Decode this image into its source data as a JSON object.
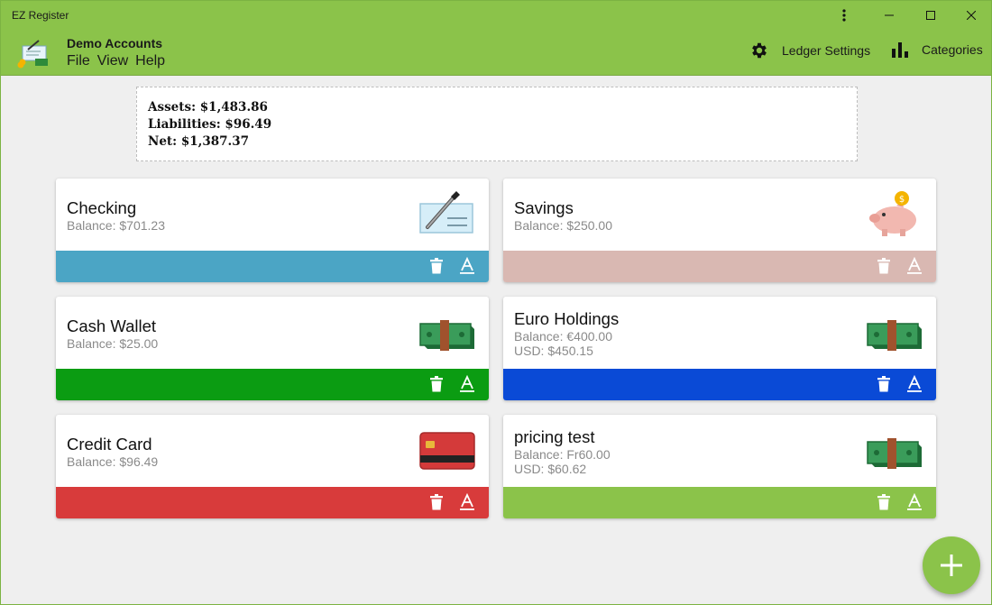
{
  "window": {
    "title": "EZ Register"
  },
  "header": {
    "ledger_name": "Demo Accounts",
    "menu": [
      "File",
      "View",
      "Help"
    ],
    "ledger_settings_label": "Ledger Settings",
    "categories_label": "Categories"
  },
  "summary": {
    "assets": "Assets: $1,483.86",
    "liabilities": "Liabilities: $96.49",
    "net": "Net: $1,387.37"
  },
  "accounts": [
    {
      "name": "Checking",
      "balance": "Balance: $701.23",
      "usd": "",
      "color": "#4ba5c5",
      "icon": "check-icon"
    },
    {
      "name": "Savings",
      "balance": "Balance: $250.00",
      "usd": "",
      "color": "#d9b8b2",
      "icon": "piggy-bank-icon"
    },
    {
      "name": "Cash Wallet",
      "balance": "Balance: $25.00",
      "usd": "",
      "color": "#0b9c12",
      "icon": "cash-icon"
    },
    {
      "name": "Euro Holdings",
      "balance": "Balance: €400.00",
      "usd": "USD: $450.15",
      "color": "#0a4ad6",
      "icon": "cash-icon"
    },
    {
      "name": "Credit Card",
      "balance": "Balance: $96.49",
      "usd": "",
      "color": "#d83b3b",
      "icon": "credit-card-icon"
    },
    {
      "name": "pricing test",
      "balance": "Balance: Fr60.00",
      "usd": "USD: $60.62",
      "color": "#8bc34a",
      "icon": "cash-icon"
    }
  ],
  "colors": {
    "accent": "#8bc34a",
    "background": "#efefef"
  }
}
